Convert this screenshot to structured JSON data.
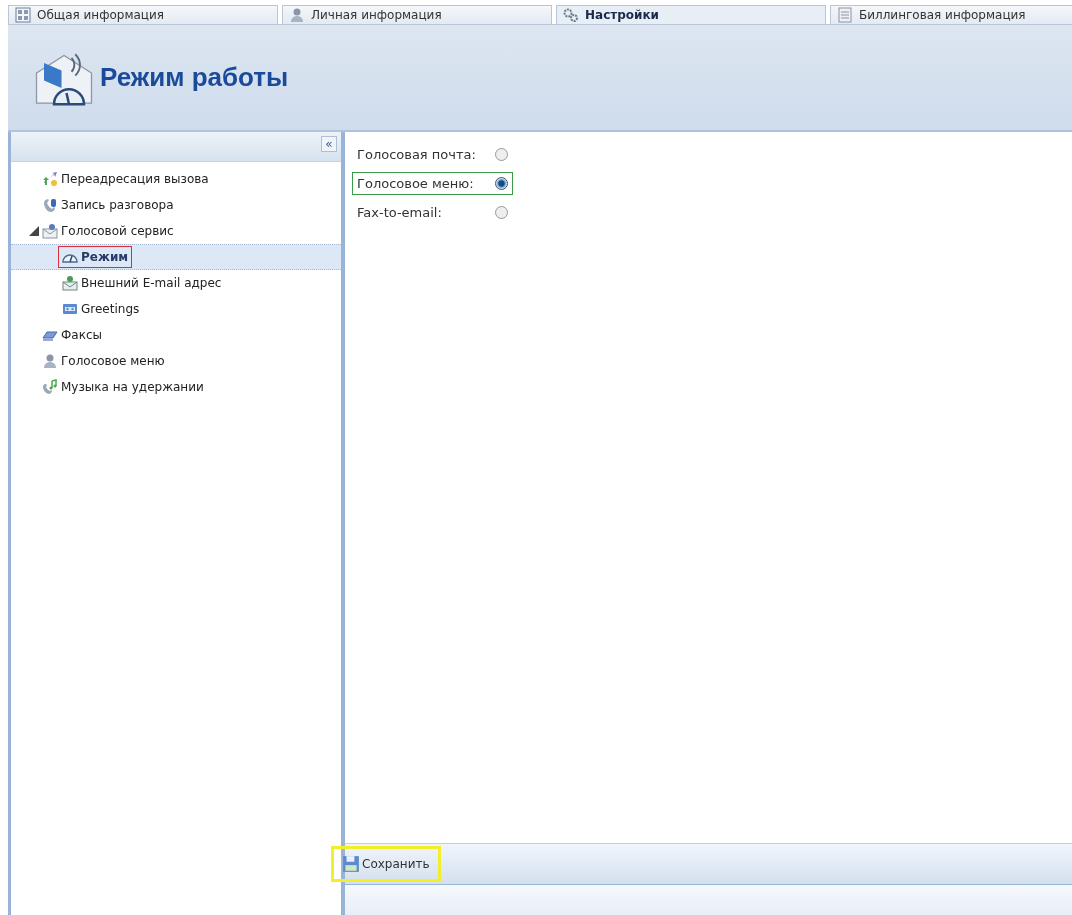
{
  "tabs": [
    {
      "label": "Общая информация",
      "kind": "grid",
      "selected": false
    },
    {
      "label": "Личная информация",
      "kind": "person",
      "selected": false
    },
    {
      "label": "Настройки",
      "kind": "gears",
      "selected": true
    },
    {
      "label": "Биллинговая информация",
      "kind": "document",
      "selected": false
    }
  ],
  "header": {
    "title": "Режим работы"
  },
  "sidebar": {
    "collapse_button": "«",
    "tree": [
      {
        "label": "Переадресация вызова",
        "kind": "arrows",
        "selected": false
      },
      {
        "label": "Запись разговора",
        "kind": "phone",
        "selected": false
      },
      {
        "label": "Голосовой сервис",
        "kind": "envelope",
        "selected": false,
        "expanded": true,
        "children": [
          {
            "label": "Режим",
            "kind": "gauge",
            "selected": true,
            "color": "#d9303f"
          },
          {
            "label": "Внешний E-mail адрес",
            "kind": "mail",
            "selected": false
          },
          {
            "label": "Greetings",
            "kind": "tape",
            "selected": false
          }
        ]
      },
      {
        "label": "Факсы",
        "kind": "fax",
        "selected": false
      },
      {
        "label": "Голосовое меню",
        "kind": "person",
        "selected": false
      },
      {
        "label": "Музыка на удержании",
        "kind": "music",
        "selected": false
      }
    ]
  },
  "options": [
    {
      "label": "Голосовая почта:",
      "selected": false
    },
    {
      "label": "Голосовое меню:",
      "selected": true,
      "color": "#3a9a4a"
    },
    {
      "label": "Fax-to-email:",
      "selected": false
    }
  ],
  "toolbar": {
    "save_button": {
      "label": "Сохранить",
      "color": "#f2ee2a"
    }
  }
}
